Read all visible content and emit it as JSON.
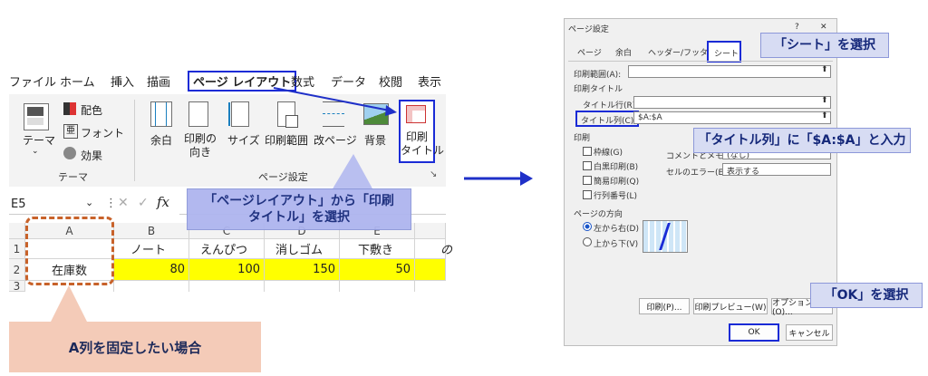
{
  "ribbon": {
    "tabs": [
      "ファイル",
      "ホーム",
      "挿入",
      "描画",
      "ページ レイアウト",
      "数式",
      "データ",
      "校閲",
      "表示"
    ],
    "theme": {
      "theme_label": "テーマ",
      "colors_label": "配色",
      "fonts_label": "フォント",
      "effects_label": "効果",
      "group_label": "テーマ"
    },
    "page_setup": {
      "margins_label": "余白",
      "orientation_label": "印刷の\n向き",
      "size_label": "サイズ",
      "print_area_label": "印刷範囲",
      "breaks_label": "改ページ",
      "background_label": "背景",
      "print_titles_label": "印刷\nタイトル",
      "group_label": "ページ設定"
    }
  },
  "formula_bar": {
    "name_box": "E5",
    "fx": "fx"
  },
  "sheet": {
    "columns": [
      "A",
      "B",
      "C",
      "D",
      "E"
    ],
    "rows": [
      "1",
      "2",
      "3"
    ],
    "row1": [
      "",
      "ノート",
      "えんぴつ",
      "消しゴム",
      "下敷き",
      "の"
    ],
    "row2": [
      "在庫数",
      "80",
      "100",
      "150",
      "50"
    ]
  },
  "callouts": {
    "ribbon_instruction": "「ページレイアウト」から「印刷\nタイトル」を選択",
    "fix_column_a": "A列を固定したい場合",
    "select_sheet": "「シート」を選択",
    "title_column_input": "「タイトル列」に「$A:$A」と入力",
    "select_ok": "「OK」を選択"
  },
  "dialog": {
    "title": "ページ設定",
    "help": "?",
    "close": "✕",
    "tabs": [
      "ページ",
      "余白",
      "ヘッダー/フッター",
      "シート"
    ],
    "print_area_label": "印刷範囲(A):",
    "print_titles_label": "印刷タイトル",
    "title_rows_label": "タイトル行(R):",
    "title_columns_label": "タイトル列(C):",
    "title_columns_value": "$A:$A",
    "print_section_label": "印刷",
    "checkboxes": [
      "枠線(G)",
      "白黒印刷(B)",
      "簡易印刷(Q)",
      "行列番号(L)"
    ],
    "comments_label": "コメントとメモ(M):",
    "comments_value": "(なし)",
    "errors_label": "セルのエラー(E):",
    "errors_value": "表示する",
    "page_order_label": "ページの方向",
    "order_options": [
      "左から右(D)",
      "上から下(V)"
    ],
    "buttons": {
      "print": "印刷(P)...",
      "preview": "印刷プレビュー(W)",
      "options": "オプション(O)...",
      "ok": "OK",
      "cancel": "キャンセル"
    }
  },
  "colors": {
    "accent_blue": "#1a2bd6",
    "callout_fill": "#d7dcf3",
    "orange_dash": "#c8622a",
    "peach_fill": "#f4cbb8",
    "arrow_blue": "#1f30c8"
  }
}
